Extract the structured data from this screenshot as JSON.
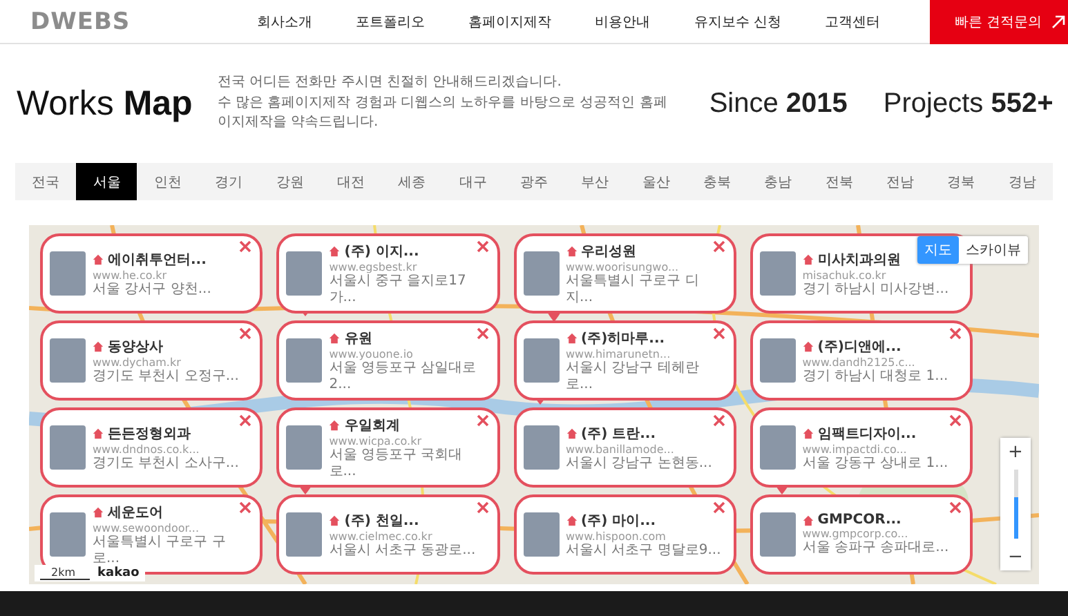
{
  "header": {
    "logo": "DWEBS",
    "nav": [
      "회사소개",
      "포트폴리오",
      "홈페이지제작",
      "비용안내",
      "유지보수 신청",
      "고객센터"
    ],
    "cta": "빠른 견적문의"
  },
  "intro": {
    "title": "Works **Map**",
    "description": [
      "전국 어디든 전화만 주시면 친절히 안내해드리겠습니다.",
      "수 많은 홈페이지제작 경험과 디웹스의 노하우를 바탕으로 성공적인 홈페이지제작을 약속드립니다."
    ],
    "since": "Since **2015**",
    "projects": "Projects **552+**"
  },
  "regions": [
    {
      "label": "전국",
      "selected": false
    },
    {
      "label": "서울",
      "selected": true
    },
    {
      "label": "인천",
      "selected": false
    },
    {
      "label": "경기",
      "selected": false
    },
    {
      "label": "강원",
      "selected": false
    },
    {
      "label": "대전",
      "selected": false
    },
    {
      "label": "세종",
      "selected": false
    },
    {
      "label": "대구",
      "selected": false
    },
    {
      "label": "광주",
      "selected": false
    },
    {
      "label": "부산",
      "selected": false
    },
    {
      "label": "울산",
      "selected": false
    },
    {
      "label": "충북",
      "selected": false
    },
    {
      "label": "충남",
      "selected": false
    },
    {
      "label": "전북",
      "selected": false
    },
    {
      "label": "전남",
      "selected": false
    },
    {
      "label": "경북",
      "selected": false
    },
    {
      "label": "경남",
      "selected": false
    }
  ],
  "map": {
    "view_toggle": [
      {
        "label": "지도",
        "selected": true
      },
      {
        "label": "스카이뷰",
        "selected": false
      }
    ],
    "zoom": {
      "in": "+",
      "out": "−",
      "level": 0.6
    },
    "scale": "2km",
    "provider": "kakao",
    "places": [
      {
        "name": "에이취투언터...",
        "url": "www.he.co.kr",
        "address": "서울 강서구 양천..."
      },
      {
        "name": "(주) 이지...",
        "url": "www.egsbest.kr",
        "address": "서울시 중구 을지로17가..."
      },
      {
        "name": "우리성원",
        "url": "www.woorisungwo...",
        "address": "서울특별시 구로구 디지..."
      },
      {
        "name": "미사치과의원",
        "url": "misachuk.co.kr",
        "address": "경기 하남시 미사강변..."
      },
      {
        "name": "동양상사",
        "url": "www.dycham.kr",
        "address": "경기도 부천시 오정구..."
      },
      {
        "name": "유원",
        "url": "www.youone.io",
        "address": "서울 영등포구 삼일대로2..."
      },
      {
        "name": "(주)히마루...",
        "url": "www.himarunetn...",
        "address": "서울시 강남구 테헤란로..."
      },
      {
        "name": "(주)디앤에...",
        "url": "www.dandh2125.c...",
        "address": "경기 하남시 대청로 1..."
      },
      {
        "name": "든든정형외과",
        "url": "www.dndnos.co.k...",
        "address": "경기도 부천시 소사구..."
      },
      {
        "name": "우일회계",
        "url": "www.wicpa.co.kr",
        "address": "서울 영등포구 국회대로..."
      },
      {
        "name": "(주) 트란...",
        "url": "www.banillamode...",
        "address": "서울시 강남구 논현동..."
      },
      {
        "name": "임팩트디자이...",
        "url": "www.impactdi.co...",
        "address": "서울 강동구 상내로 1..."
      },
      {
        "name": "세운도어",
        "url": "www.sewoondoor...",
        "address": "서울특별시 구로구 구로..."
      },
      {
        "name": "(주) 천일...",
        "url": "www.cielmec.co.kr",
        "address": "서울시 서초구 동광로..."
      },
      {
        "name": "(주) 마이...",
        "url": "www.hispoon.com",
        "address": "서울시 서초구 명달로9..."
      },
      {
        "name": "GMPCOR...",
        "url": "www.gmpcorp.co...",
        "address": "서울 송파구 송파대로..."
      }
    ]
  }
}
